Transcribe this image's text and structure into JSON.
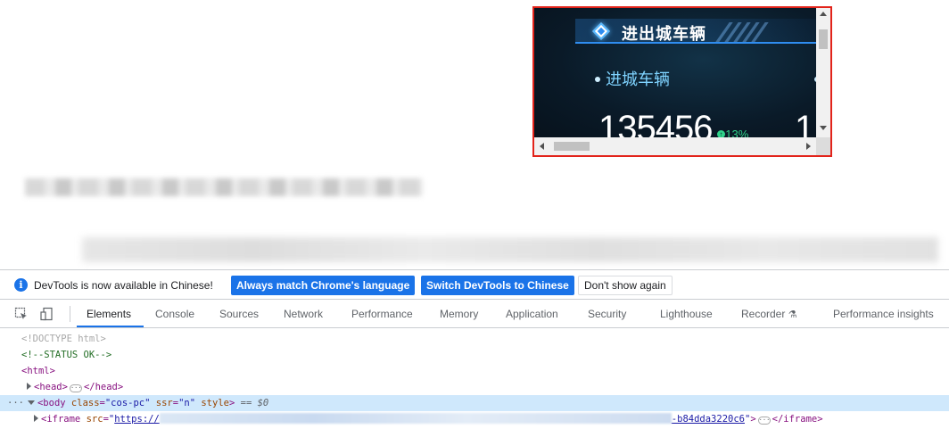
{
  "widget": {
    "title": "进出城车辆",
    "subtitle": "进城车辆",
    "value": "135456",
    "change": "13%",
    "value2_partial": "1",
    "colors": {
      "accent": "#2f8df0",
      "up": "#2fd38a",
      "border": "#e2231a"
    }
  },
  "devtools": {
    "info_text": "DevTools is now available in Chinese!",
    "btn_match": "Always match Chrome's language",
    "btn_switch": "Switch DevTools to Chinese",
    "btn_dismiss": "Don't show again",
    "tabs": [
      "Elements",
      "Console",
      "Sources",
      "Network",
      "Performance",
      "Memory",
      "Application",
      "Security",
      "Lighthouse",
      "Recorder",
      "Performance insights"
    ],
    "active_tab": "Elements",
    "code": {
      "doctype": "<!DOCTYPE html>",
      "comment": "<!--STATUS OK-->",
      "html_open": "<html>",
      "head_open": "<head>",
      "head_close": "</head>",
      "body_tag": "body",
      "body_class_attr": "class",
      "body_class_val": "\"cos-pc\"",
      "body_ssr_attr": "ssr",
      "body_ssr_val": "\"n\"",
      "body_style_attr": "style",
      "body_suffix": "== $0",
      "iframe_tag": "iframe",
      "iframe_src_attr": "src",
      "iframe_src_start": "https://",
      "iframe_src_end": "-b84dda3220c6",
      "iframe_close": "</iframe>"
    }
  }
}
